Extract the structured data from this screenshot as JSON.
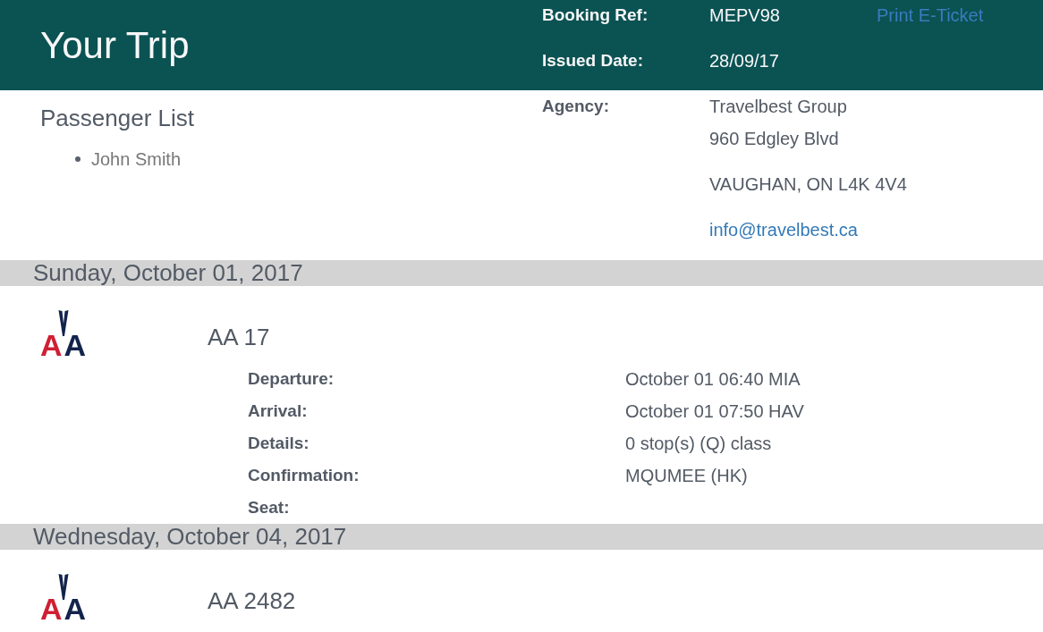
{
  "header": {
    "title": "Your Trip",
    "fields": [
      {
        "label": "Booking Ref:",
        "value": "MEPV98"
      },
      {
        "label": "Issued Date:",
        "value": "28/09/17"
      }
    ],
    "print_link": "Print E-Ticket"
  },
  "passengers": {
    "heading": "Passenger List",
    "names": [
      "John Smith"
    ]
  },
  "agency": {
    "label": "Agency:",
    "name": "Travelbest Group",
    "address": [
      "960 Edgley Blvd",
      "VAUGHAN, ON L4K 4V4"
    ],
    "email": "info@travelbest.ca"
  },
  "days": [
    {
      "date": "Sunday, October 01, 2017",
      "flights": [
        {
          "logo_text": "AA",
          "flight": "AA 17",
          "details": [
            {
              "label": "Departure:",
              "value": "October 01 06:40 MIA"
            },
            {
              "label": "Arrival:",
              "value": "October 01 07:50 HAV"
            },
            {
              "label": "Details:",
              "value": "0 stop(s) (Q) class"
            },
            {
              "label": "Confirmation:",
              "value": "MQUMEE (HK)"
            },
            {
              "label": "Seat:"
            }
          ]
        }
      ]
    },
    {
      "date": "Wednesday, October 04, 2017",
      "flights": [
        {
          "logo_text": "AA",
          "flight": "AA 2482"
        }
      ]
    }
  ]
}
